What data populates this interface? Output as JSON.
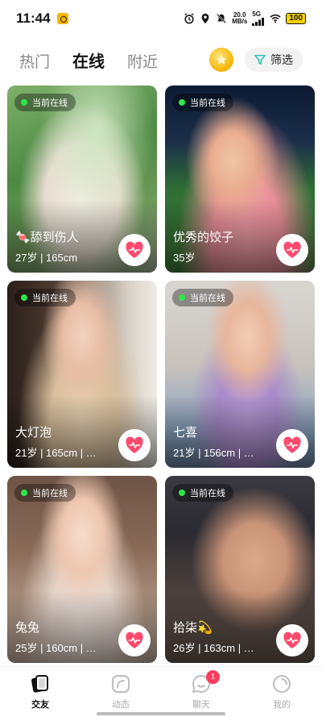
{
  "status_bar": {
    "time": "11:44",
    "net_speed_value": "20.0",
    "net_speed_unit": "MB/s",
    "network": "5G",
    "battery": "100"
  },
  "header": {
    "tabs": [
      {
        "label": "热门",
        "active": false
      },
      {
        "label": "在线",
        "active": true
      },
      {
        "label": "附近",
        "active": false
      }
    ],
    "filter_label": "筛选"
  },
  "online_label": "当前在线",
  "profiles": [
    {
      "name": "🍬舔到伤人",
      "info": "27岁 | 165cm"
    },
    {
      "name": "优秀的饺子",
      "info": "35岁"
    },
    {
      "name": "大灯泡",
      "info": "21岁 | 165cm | …"
    },
    {
      "name": "七喜",
      "info": "21岁 | 156cm | …"
    },
    {
      "name": "兔兔",
      "info": "25岁 | 160cm | …"
    },
    {
      "name": "拾柒💫",
      "info": "26岁 | 163cm | …"
    }
  ],
  "bottom_nav": {
    "items": [
      {
        "label": "交友",
        "active": true
      },
      {
        "label": "动态",
        "active": false
      },
      {
        "label": "聊天",
        "active": false,
        "badge": "1"
      },
      {
        "label": "我的",
        "active": false
      }
    ]
  },
  "colors": {
    "online_dot": "#2ee64a",
    "like_heart": "#ff4a6e",
    "badge": "#ff3b5c",
    "coin": "#f5b400",
    "filter_icon": "#2ec4b6"
  }
}
